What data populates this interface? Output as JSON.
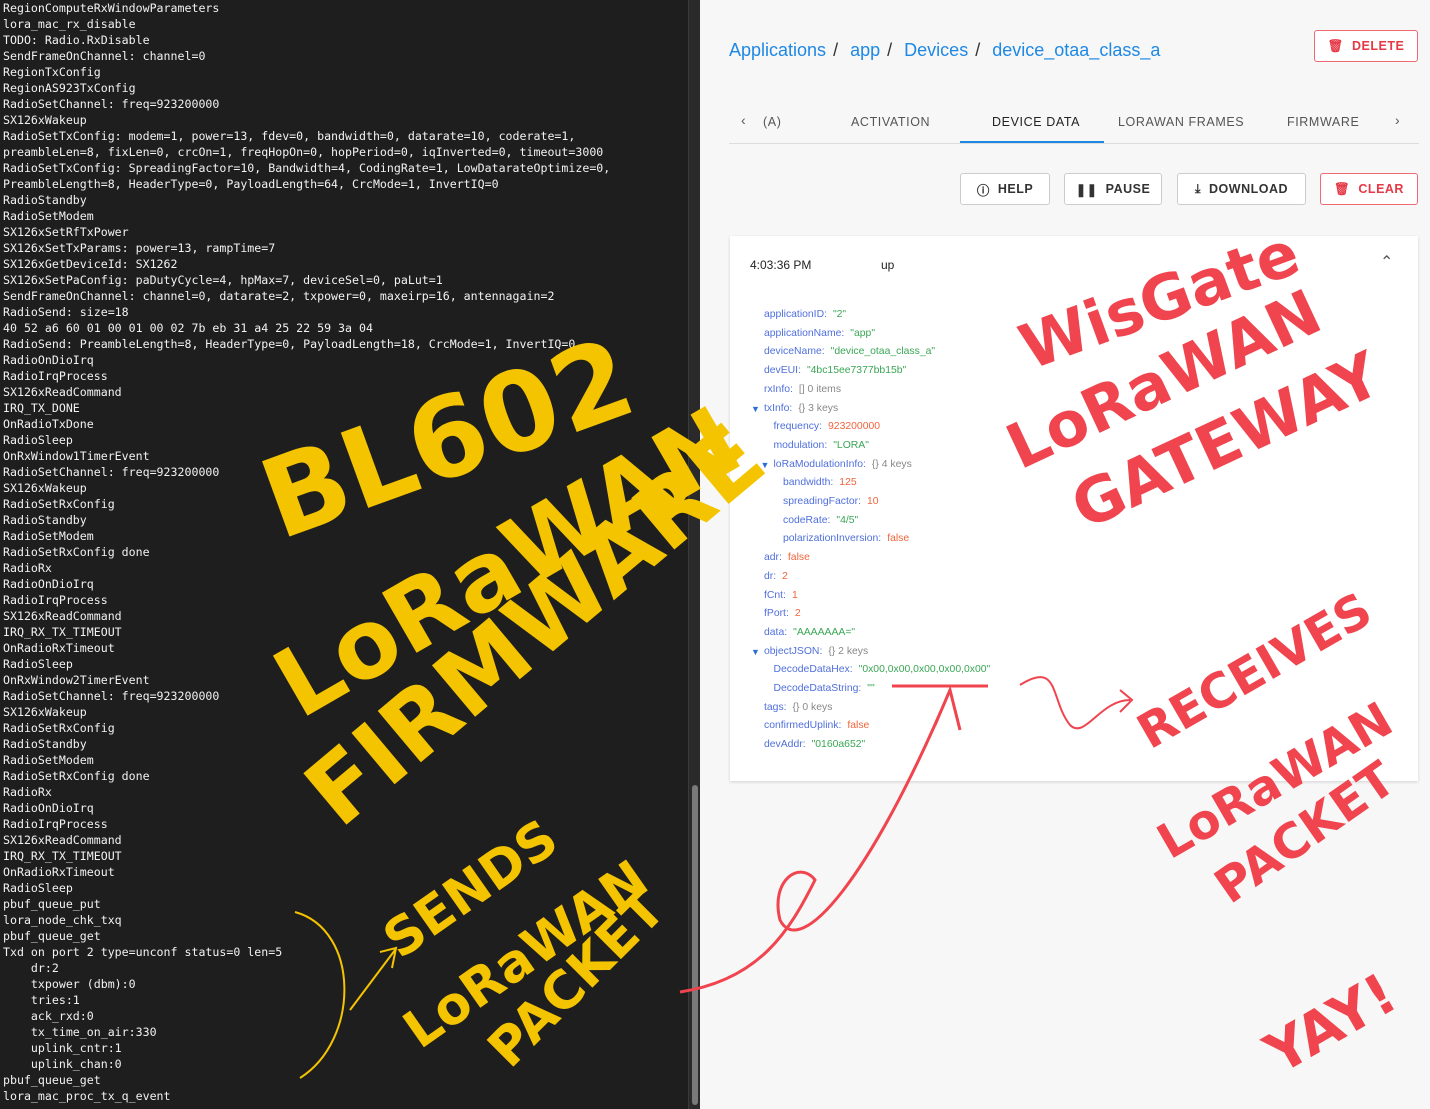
{
  "terminal": {
    "lines": [
      "RegionComputeRxWindowParameters",
      "lora_mac_rx_disable",
      "TODO: Radio.RxDisable",
      "SendFrameOnChannel: channel=0",
      "RegionTxConfig",
      "RegionAS923TxConfig",
      "RadioSetChannel: freq=923200000",
      "SX126xWakeup",
      "RadioSetTxConfig: modem=1, power=13, fdev=0, bandwidth=0, datarate=10, coderate=1,",
      "preambleLen=8, fixLen=0, crcOn=1, freqHopOn=0, hopPeriod=0, iqInverted=0, timeout=3000",
      "RadioSetTxConfig: SpreadingFactor=10, Bandwidth=4, CodingRate=1, LowDatarateOptimize=0,",
      "PreambleLength=8, HeaderType=0, PayloadLength=64, CrcMode=1, InvertIQ=0",
      "RadioStandby",
      "RadioSetModem",
      "SX126xSetRfTxPower",
      "SX126xSetTxParams: power=13, rampTime=7",
      "SX126xGetDeviceId: SX1262",
      "SX126xSetPaConfig: paDutyCycle=4, hpMax=7, deviceSel=0, paLut=1",
      "SendFrameOnChannel: channel=0, datarate=2, txpower=0, maxeirp=16, antennagain=2",
      "RadioSend: size=18",
      "40 52 a6 60 01 00 01 00 02 7b eb 31 a4 25 22 59 3a 04",
      "RadioSend: PreambleLength=8, HeaderType=0, PayloadLength=18, CrcMode=1, InvertIQ=0",
      "RadioOnDioIrq",
      "RadioIrqProcess",
      "SX126xReadCommand",
      "IRQ_TX_DONE",
      "OnRadioTxDone",
      "RadioSleep",
      "OnRxWindow1TimerEvent",
      "RadioSetChannel: freq=923200000",
      "SX126xWakeup",
      "RadioSetRxConfig",
      "RadioStandby",
      "RadioSetModem",
      "RadioSetRxConfig done",
      "RadioRx",
      "RadioOnDioIrq",
      "RadioIrqProcess",
      "SX126xReadCommand",
      "IRQ_RX_TX_TIMEOUT",
      "OnRadioRxTimeout",
      "RadioSleep",
      "OnRxWindow2TimerEvent",
      "RadioSetChannel: freq=923200000",
      "SX126xWakeup",
      "RadioSetRxConfig",
      "RadioStandby",
      "RadioSetModem",
      "RadioSetRxConfig done",
      "RadioRx",
      "RadioOnDioIrq",
      "RadioIrqProcess",
      "SX126xReadCommand",
      "IRQ_RX_TX_TIMEOUT",
      "OnRadioRxTimeout",
      "RadioSleep",
      "pbuf_queue_put",
      "lora_node_chk_txq",
      "pbuf_queue_get",
      "Txd on port 2 type=unconf status=0 len=5",
      "    dr:2",
      "    txpower (dbm):0",
      "    tries:1",
      "    ack_rxd:0",
      "    tx_time_on_air:330",
      "    uplink_cntr:1",
      "    uplink_chan:0",
      "pbuf_queue_get",
      "lora_mac_proc_tx_q_event"
    ]
  },
  "breadcrumb": [
    "Applications",
    "app",
    "Devices",
    "device_otaa_class_a"
  ],
  "delete_label": "DELETE",
  "tabs": [
    "(A)",
    "ACTIVATION",
    "DEVICE DATA",
    "LORAWAN FRAMES",
    "FIRMWARE"
  ],
  "toolbar": {
    "help": "HELP",
    "pause": "PAUSE",
    "download": "DOWNLOAD",
    "clear": "CLEAR"
  },
  "event": {
    "time": "4:03:36 PM",
    "type": "up"
  },
  "json_rows": [
    {
      "i": 0,
      "k": "applicationID:",
      "v": "\"2\"",
      "t": "s"
    },
    {
      "i": 0,
      "k": "applicationName:",
      "v": "\"app\"",
      "t": "s"
    },
    {
      "i": 0,
      "k": "deviceName:",
      "v": "\"device_otaa_class_a\"",
      "t": "s"
    },
    {
      "i": 0,
      "k": "devEUI:",
      "v": "\"4bc15ee7377bb15b\"",
      "t": "s"
    },
    {
      "i": 0,
      "k": "rxInfo:",
      "v": "[]  0 items",
      "t": "m"
    },
    {
      "i": 0,
      "k": "txInfo:",
      "v": "{}  3 keys",
      "t": "m",
      "open": true
    },
    {
      "i": 1,
      "k": "frequency:",
      "v": "923200000",
      "t": "n"
    },
    {
      "i": 1,
      "k": "modulation:",
      "v": "\"LORA\"",
      "t": "s"
    },
    {
      "i": 1,
      "k": "loRaModulationInfo:",
      "v": "{}  4 keys",
      "t": "m",
      "open": true
    },
    {
      "i": 2,
      "k": "bandwidth:",
      "v": "125",
      "t": "n"
    },
    {
      "i": 2,
      "k": "spreadingFactor:",
      "v": "10",
      "t": "n"
    },
    {
      "i": 2,
      "k": "codeRate:",
      "v": "\"4/5\"",
      "t": "s"
    },
    {
      "i": 2,
      "k": "polarizationInversion:",
      "v": "false",
      "t": "n"
    },
    {
      "i": 0,
      "k": "adr:",
      "v": "false",
      "t": "n"
    },
    {
      "i": 0,
      "k": "dr:",
      "v": "2",
      "t": "n"
    },
    {
      "i": 0,
      "k": "fCnt:",
      "v": "1",
      "t": "n"
    },
    {
      "i": 0,
      "k": "fPort:",
      "v": "2",
      "t": "n"
    },
    {
      "i": 0,
      "k": "data:",
      "v": "\"AAAAAAA=\"",
      "t": "s"
    },
    {
      "i": 0,
      "k": "objectJSON:",
      "v": "{}  2 keys",
      "t": "m",
      "open": true
    },
    {
      "i": 1,
      "k": "DecodeDataHex:",
      "v": "\"0x00,0x00,0x00,0x00,0x00\"",
      "t": "s"
    },
    {
      "i": 1,
      "k": "DecodeDataString:",
      "v": "\"\"",
      "t": "s"
    },
    {
      "i": 0,
      "k": "tags:",
      "v": "{}  0 keys",
      "t": "m"
    },
    {
      "i": 0,
      "k": "confirmedUplink:",
      "v": "false",
      "t": "n"
    },
    {
      "i": 0,
      "k": "devAddr:",
      "v": "\"0160a652\"",
      "t": "s"
    }
  ],
  "annotations": {
    "yellow": [
      "BL602",
      "LoRaWAN",
      "FIRMWARE",
      "SENDS",
      "LoRaWAN",
      "PACKET"
    ],
    "red": [
      "WisGate",
      "LoRaWAN",
      "GATEWAY",
      "RECEIVES",
      "LoRaWAN",
      "PACKET",
      "YAY!"
    ]
  },
  "colors": {
    "accent": "#1e88e5",
    "danger": "#e53946",
    "yellow_ink": "#f5c400",
    "red_ink": "#f0444e"
  }
}
